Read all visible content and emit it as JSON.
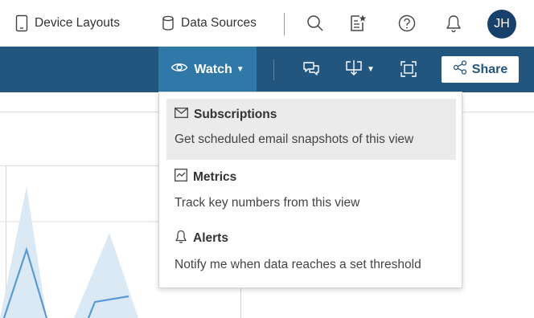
{
  "header": {
    "device_layouts_label": "Device Layouts",
    "data_sources_label": "Data Sources",
    "avatar_initials": "JH"
  },
  "toolbar": {
    "watch_label": "Watch",
    "share_label": "Share"
  },
  "watch_menu": {
    "items": [
      {
        "title": "Subscriptions",
        "description": "Get scheduled email snapshots of this view",
        "icon": "envelope-icon",
        "highlighted": true
      },
      {
        "title": "Metrics",
        "description": "Track key numbers from this view",
        "icon": "metrics-icon",
        "highlighted": false
      },
      {
        "title": "Alerts",
        "description": "Notify me when data reaches a set threshold",
        "icon": "bell-icon",
        "highlighted": false
      }
    ]
  },
  "colors": {
    "toolbar_bg": "#22567f",
    "watch_active_bg": "#2f78a8",
    "avatar_bg": "#17416b",
    "menu_highlight": "#ebebeb"
  }
}
